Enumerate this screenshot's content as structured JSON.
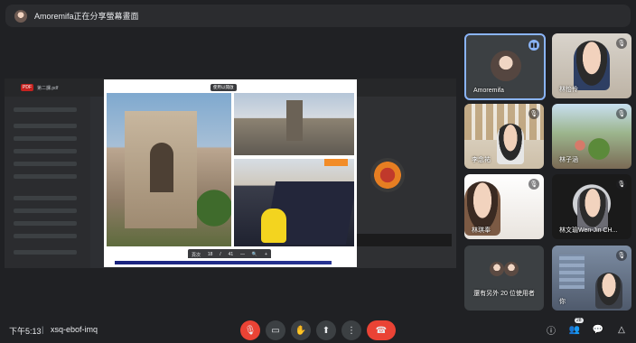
{
  "presentation": {
    "title": "Amoremifa正在分享螢幕畫面"
  },
  "share": {
    "app_tag": "PDF",
    "doc_title": "第二課.pdf",
    "open_button": "使用以開啟",
    "pager": {
      "label": "頁次",
      "page": "18",
      "sep": "/",
      "total": "41",
      "minus": "—",
      "zoom": "🔍",
      "plus": "+"
    }
  },
  "participants": [
    {
      "name": "Amoremifa",
      "mic": "speaking"
    },
    {
      "name": "林怡伶",
      "mic": "muted"
    },
    {
      "name": "李念祐",
      "mic": "muted"
    },
    {
      "name": "林子涵",
      "mic": "muted"
    },
    {
      "name": "林琪奉",
      "mic": "muted"
    },
    {
      "name": "林文瑜Wen-Jin CH...",
      "mic": "muted"
    },
    {
      "name": "還有另外 20 位使用者",
      "mic": "none"
    },
    {
      "name": "你",
      "mic": "muted"
    }
  ],
  "bottom": {
    "time": "下午5:13",
    "separator": "|",
    "meeting_code": "xsq-ebof-imq",
    "participant_count": "28"
  },
  "icons": {
    "mic_off": "🎙",
    "camera": "▭",
    "raise_hand": "✋",
    "present": "⬆",
    "more": "⋮",
    "hang_up": "☎",
    "info": "ⓘ",
    "people": "👥",
    "chat": "💬",
    "activities": "△"
  },
  "colors": {
    "accent": "#8ab4f8",
    "danger": "#ea4335",
    "bg": "#202124"
  }
}
